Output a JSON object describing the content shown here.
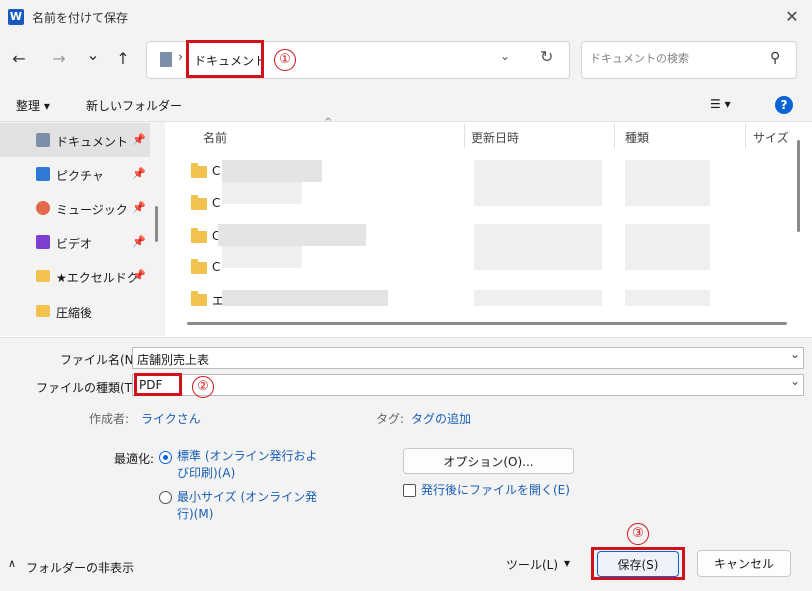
{
  "window": {
    "title": "名前を付けて保存",
    "app_icon_letter": "W",
    "close_glyph": "✕"
  },
  "nav": {
    "back": "←",
    "forward": "→",
    "recent": "⌄",
    "up": "↑",
    "address_sep": "›",
    "address": "ドキュメント",
    "address_chevron": "⌄",
    "refresh": "↻",
    "search_placeholder": "ドキュメントの検索",
    "search_glyph": "⚲"
  },
  "toolbar": {
    "organize": "整理 ▾",
    "new_folder": "新しいフォルダー",
    "view": "☰ ▾",
    "help": "?"
  },
  "sidebar": {
    "pin": "📌",
    "items": [
      {
        "label": "ドキュメント",
        "icon": "document-icon",
        "pinned": true,
        "selected": true
      },
      {
        "label": "ピクチャ",
        "icon": "pictures-icon",
        "pinned": true
      },
      {
        "label": "ミュージック",
        "icon": "music-icon",
        "pinned": true
      },
      {
        "label": "ビデオ",
        "icon": "video-icon",
        "pinned": true
      },
      {
        "label": "★エクセルドク",
        "icon": "folder-icon",
        "pinned": true
      },
      {
        "label": "圧縮後",
        "icon": "folder-icon",
        "pinned": false
      }
    ]
  },
  "filelist": {
    "columns": [
      "名前",
      "更新日時",
      "種類",
      "サイズ"
    ],
    "sort_arrow": "^",
    "rows": [
      {
        "name": "C"
      },
      {
        "name": "C"
      },
      {
        "name": "C"
      },
      {
        "name": "C"
      },
      {
        "name": "エ"
      }
    ]
  },
  "annotations": {
    "n1": "①",
    "n2": "②",
    "n3": "③"
  },
  "form": {
    "filename_label": "ファイル名(N):",
    "filename_value": "店舗別売上表",
    "filetype_label": "ファイルの種類(T):",
    "filetype_value": "PDF",
    "chevron": "⌄",
    "author_label": "作成者:",
    "author_value": "ライクさん",
    "tags_label": "タグ:",
    "tags_value": "タグの追加",
    "optimize_label": "最適化:",
    "opt1_line1": "標準 (オンライン発行およ",
    "opt1_line2": "び印刷)(A)",
    "opt2_line1": "最小サイズ (オンライン発",
    "opt2_line2": "行)(M)",
    "options_button": "オプション(O)...",
    "open_after": "発行後にファイルを開く(E)"
  },
  "footer": {
    "hide_folders": "フォルダーの非表示",
    "hide_chevron": "∧",
    "tools": "ツール(L)",
    "tools_arrow": "▾",
    "save": "保存(S)",
    "cancel": "キャンセル"
  }
}
